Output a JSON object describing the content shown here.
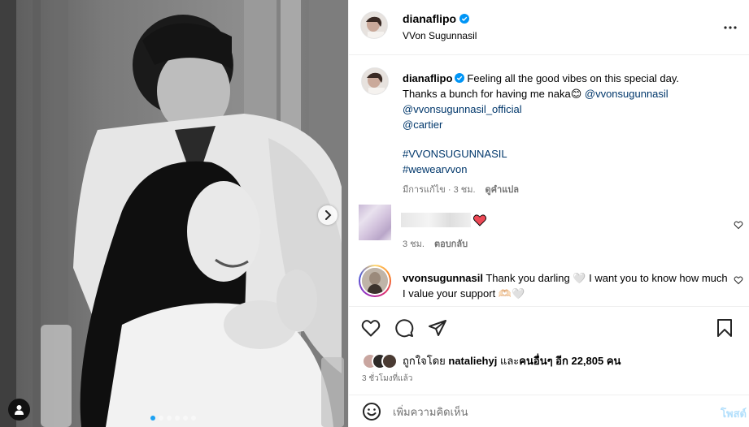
{
  "header": {
    "username": "dianaflipo",
    "subtitle": "VVon Sugunnasil",
    "more_icon": "more-horizontal-icon",
    "verified_icon": "verified-badge-icon"
  },
  "caption": {
    "username": "dianaflipo",
    "line1": "Feeling all the good vibes on this special day.",
    "line2_text": "Thanks a bunch for having me naka",
    "line2_emoji": "😊",
    "mention1": "@vvonsugunnasil",
    "mention2": "@vvonsugunnasil_official",
    "mention3": "@cartier",
    "hashtag1": "#VVONSUGUNNASIL",
    "hashtag2": "#wewearvvon",
    "edited": "มีการแก้ไข · 3 ชม.",
    "see_translation": "ดูคำแปล"
  },
  "reply1": {
    "time": "3 ชม.",
    "reply_label": "ตอบกลับ",
    "heart_color": "#ed4956"
  },
  "reply2": {
    "username": "vvonsugunnasil",
    "text": "Thank you darling 🤍 I want you to know how much I value your support 🫶🏻🤍"
  },
  "actions": {
    "liked_prefix": "ถูกใจโดย ",
    "liked_user": "nataliehyj",
    "liked_mid": " และ",
    "liked_others": "คนอื่นๆ อีก 22,805 คน",
    "time_ago": "3 ชั่วโมงที่แล้ว"
  },
  "add_comment": {
    "placeholder": "เพิ่มความคิดเห็น",
    "post_label": "โพสต์"
  },
  "photo": {
    "carousel_total": 6,
    "carousel_active": 1
  },
  "colors": {
    "link": "#00376b",
    "verified": "#0095f6",
    "active_dot": "#1da1f2"
  }
}
